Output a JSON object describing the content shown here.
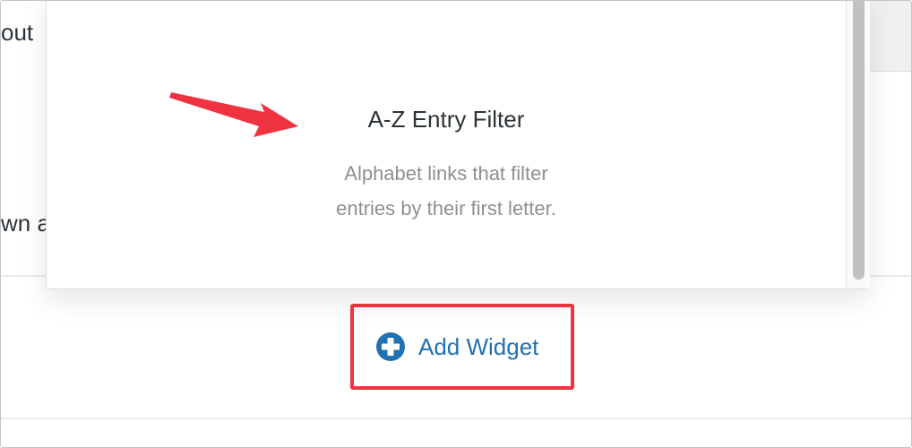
{
  "background": {
    "text_fragment_1": "out",
    "text_fragment_2": "wn a"
  },
  "popup": {
    "widget_title": "A-Z Entry Filter",
    "widget_description_line1": "Alphabet links that filter",
    "widget_description_line2": "entries by their first letter."
  },
  "add_widget": {
    "label": "Add Widget",
    "icon": "plus-circle-icon"
  },
  "colors": {
    "accent_blue": "#2271b1",
    "highlight_red": "#ef3340",
    "arrow_red": "#ef3340"
  }
}
